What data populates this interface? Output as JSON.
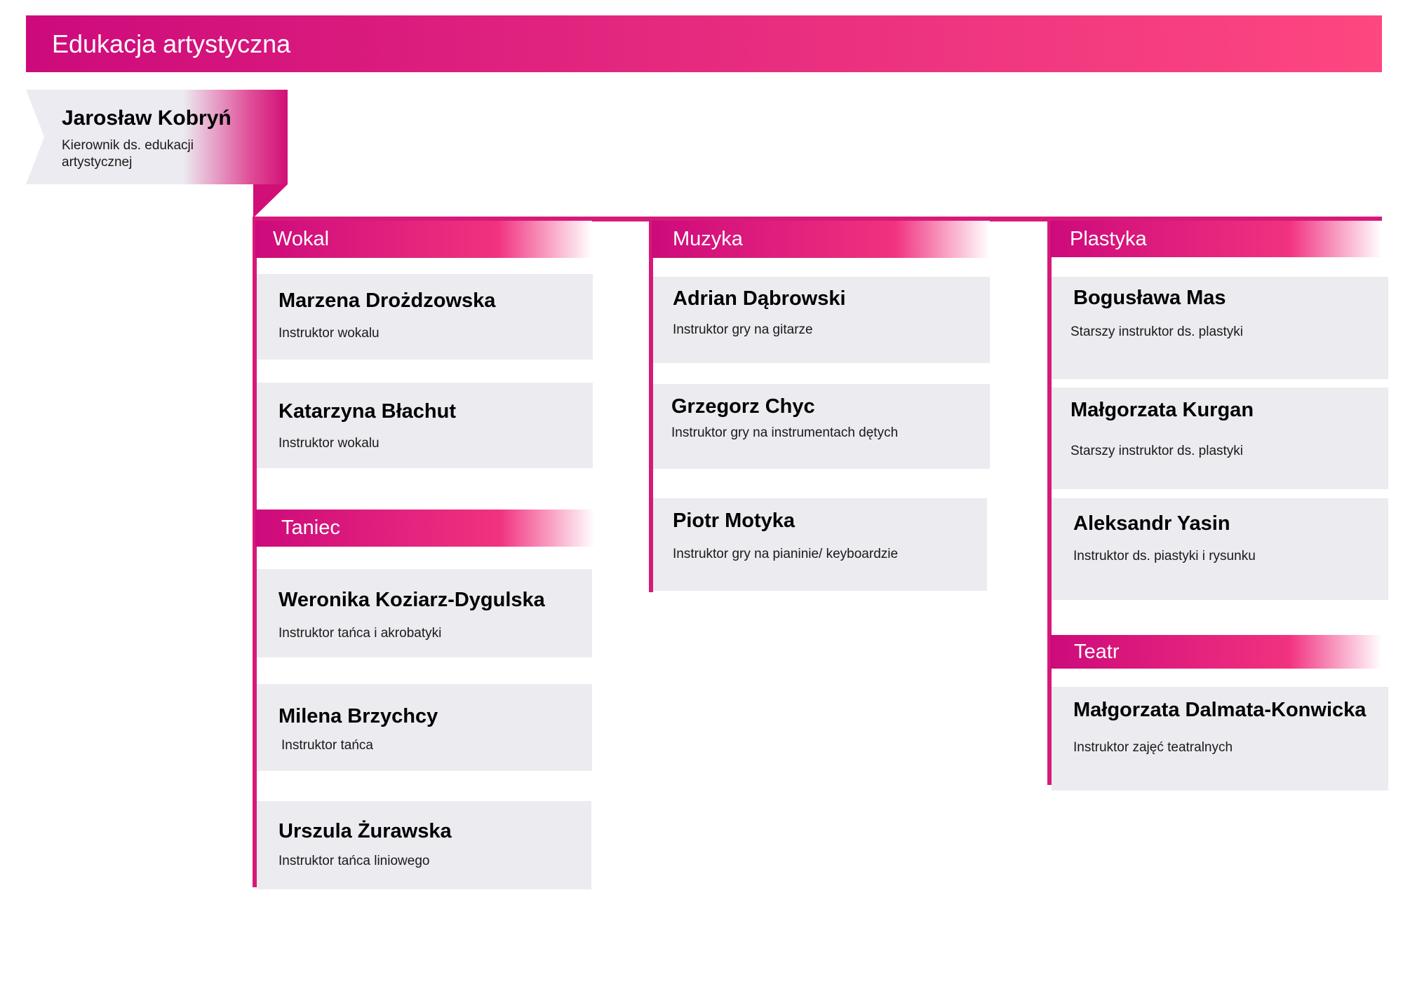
{
  "title": "Edukacja artystyczna",
  "head": {
    "name": "Jarosław Kobryń",
    "role": "Kierownik ds. edukacji artystycznej"
  },
  "departments": {
    "wokal": {
      "label": "Wokal",
      "members": [
        {
          "name": "Marzena Drożdzowska",
          "role": "Instruktor wokalu"
        },
        {
          "name": "Katarzyna Błachut",
          "role": "Instruktor wokalu"
        }
      ]
    },
    "taniec": {
      "label": "Taniec",
      "members": [
        {
          "name": "Weronika Koziarz-Dygulska",
          "role": "Instruktor tańca i akrobatyki"
        },
        {
          "name": "Milena Brzychcy",
          "role": "Instruktor tańca"
        },
        {
          "name": "Urszula Żurawska",
          "role": "Instruktor tańca liniowego"
        }
      ]
    },
    "muzyka": {
      "label": "Muzyka",
      "members": [
        {
          "name": "Adrian Dąbrowski",
          "role": "Instruktor gry na gitarze"
        },
        {
          "name": "Grzegorz Chyc",
          "role": "Instruktor gry na instrumentach dętych"
        },
        {
          "name": "Piotr Motyka",
          "role": "Instruktor gry na pianinie/ keyboardzie"
        }
      ]
    },
    "plastyka": {
      "label": "Plastyka",
      "members": [
        {
          "name": "Bogusława Mas",
          "role": "Starszy instruktor ds. plastyki"
        },
        {
          "name": "Małgorzata Kurgan",
          "role": "Starszy instruktor ds. plastyki"
        },
        {
          "name": "Aleksandr Yasin",
          "role": "Instruktor ds. piastyki i rysunku"
        }
      ]
    },
    "teatr": {
      "label": "Teatr",
      "members": [
        {
          "name": "Małgorzata Dalmata-Konwicka",
          "role": "Instruktor zajęć teatralnych"
        }
      ]
    }
  },
  "colors": {
    "accent": "#d61a7a",
    "gradient_start": "#cd0a7b",
    "gradient_end": "#fd4780",
    "card": "#ebebf0"
  }
}
